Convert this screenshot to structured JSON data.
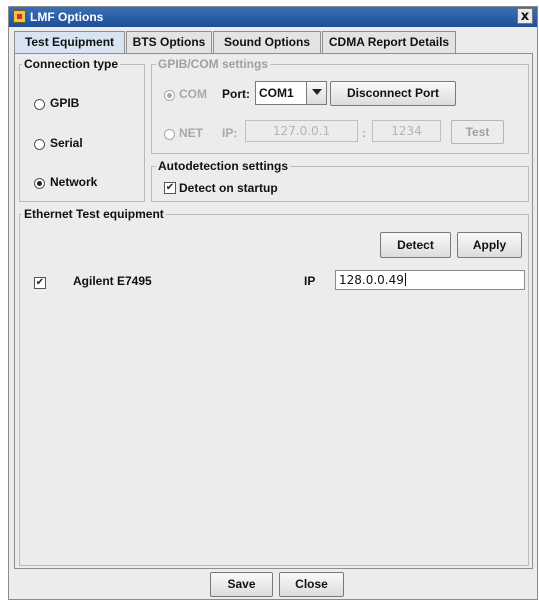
{
  "window": {
    "title": "LMF Options",
    "close_label": "x"
  },
  "tabs": [
    {
      "label": "Test Equipment",
      "active": true
    },
    {
      "label": "BTS Options",
      "active": false
    },
    {
      "label": "Sound Options",
      "active": false
    },
    {
      "label": "CDMA Report Details",
      "active": false
    }
  ],
  "connection_type": {
    "title": "Connection type",
    "options": [
      {
        "label": "GPIB",
        "selected": false
      },
      {
        "label": "Serial",
        "selected": false
      },
      {
        "label": "Network",
        "selected": true
      }
    ]
  },
  "gpib_com": {
    "title": "GPIB/COM settings",
    "com_label": "COM",
    "port_label": "Port:",
    "port_value": "COM1",
    "disconnect_label": "Disconnect Port",
    "net_label": "NET",
    "ip_label": "IP:",
    "ip_value": "127.0.0.1",
    "colon": ":",
    "port_number": "1234",
    "test_label": "Test"
  },
  "autodetection": {
    "title": "Autodetection settings",
    "check_mark": "✔",
    "detect_label": "Detect on startup",
    "checked": true
  },
  "ethernet": {
    "title": "Ethernet Test equipment",
    "detect_label": "Detect",
    "apply_label": "Apply",
    "rows": [
      {
        "check_mark": "✔",
        "name": "Agilent E7495",
        "ip_label": "IP",
        "ip_value": "128.0.0.49"
      }
    ]
  },
  "footer": {
    "save_label": "Save",
    "close_label": "Close"
  }
}
